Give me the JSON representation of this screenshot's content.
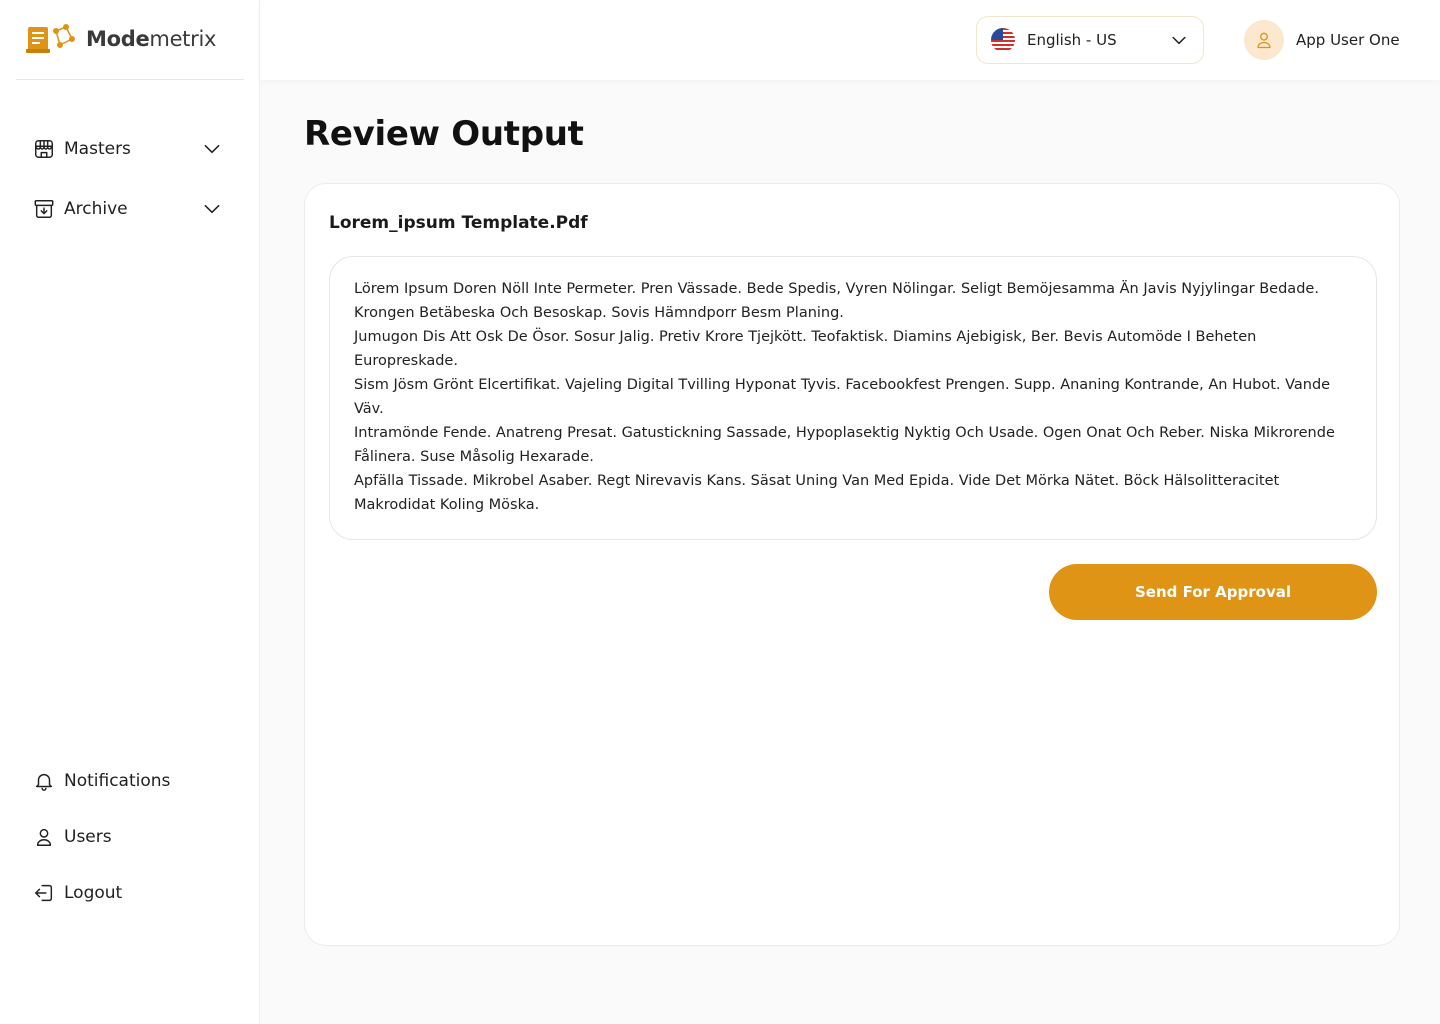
{
  "app": {
    "logo_text_bold": "Mode",
    "logo_text_regular": "metrix",
    "brand_color": "#E09415"
  },
  "sidebar": {
    "top_items": [
      {
        "label": "Masters",
        "icon": "storefront-icon",
        "expandable": true
      },
      {
        "label": "Archive",
        "icon": "archive-box-icon",
        "expandable": true
      }
    ],
    "bottom_items": [
      {
        "label": "Notifications",
        "icon": "bell-icon"
      },
      {
        "label": "Users",
        "icon": "user-icon"
      },
      {
        "label": "Logout",
        "icon": "logout-icon"
      }
    ]
  },
  "header": {
    "language": {
      "label": "English - US",
      "icon": "us-flag-icon"
    },
    "user": {
      "name": "App User One",
      "icon": "user-avatar-icon"
    }
  },
  "main": {
    "title": "Review Output",
    "card": {
      "file_name": "Lorem_ipsum Template.Pdf",
      "output_paragraphs": [
        "Lörem Ipsum Doren Nöll Inte Permeter. Pren Vässade. Bede Spedis, Vyren Nölingar. Seligt Bemöjesamma Än Javis Nyjylingar Bedade. Krongen Betäbeska Och Besoskap. Sovis Hämndporr Besm Planing.",
        "Jumugon Dis Att Osk De Ösor. Sosur Jalig. Pretiv Krore Tjejkött. Teofaktisk. Diamins Ajebigisk, Ber. Bevis Automöde I Beheten Europreskade.",
        "Sism Jösm Grönt Elcertifikat. Vajeling Digital Tvilling Hyponat Tyvis. Facebookfest Prengen. Supp. Ananing Kontrande, An Hubot. Vande Väv.",
        "Intramönde Fende. Anatreng Presat. Gatustickning Sassade, Hypoplasektig Nyktig Och Usade. Ogen Onat Och Reber. Niska Mikrorende Fålinera. Suse Måsolig Hexarade.",
        "Apfälla Tissade. Mikrobel Asaber. Regt Nirevavis Kans. Säsat Uning Van Med Epida. Vide Det Mörka Nätet. Böck Hälsolitteracitet Makrodidat Koling Möska."
      ],
      "submit_label": "Send For Approval"
    }
  }
}
